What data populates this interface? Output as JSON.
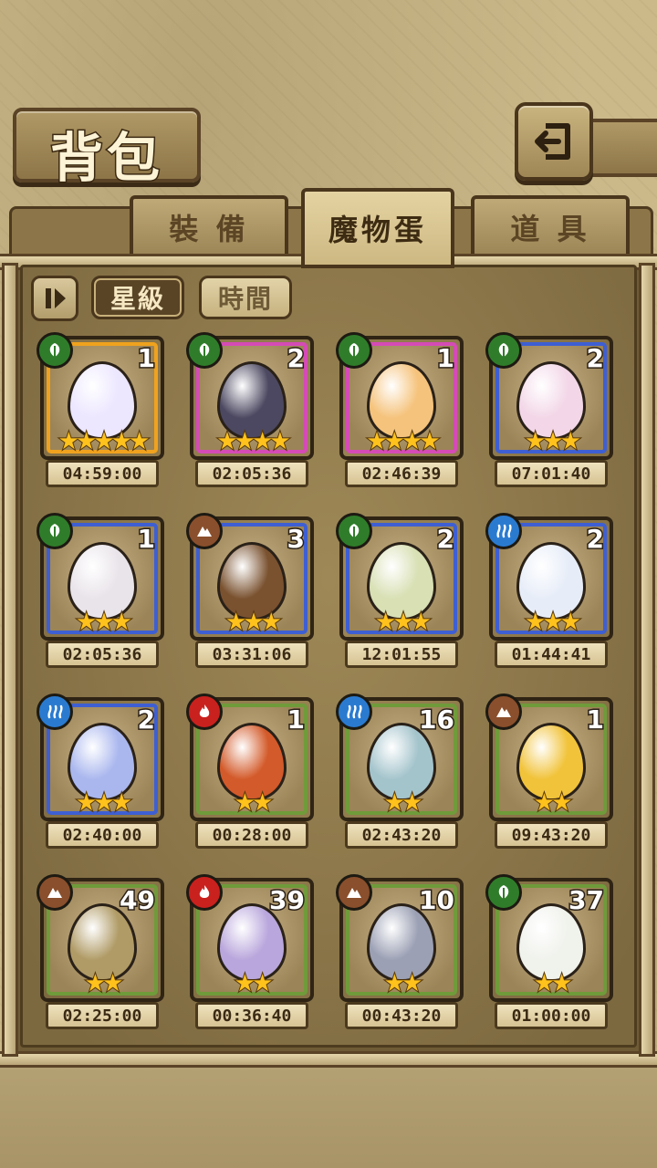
{
  "title": "背包",
  "tabs": [
    {
      "label": "裝 備",
      "active": false
    },
    {
      "label": "魔物蛋",
      "active": true
    },
    {
      "label": "道 具",
      "active": false
    }
  ],
  "filters": [
    {
      "label": "星級",
      "active": true
    },
    {
      "label": "時間",
      "active": false
    }
  ],
  "colors": {
    "rim_gold": "#f0a21e",
    "rim_pink": "#d54bb6",
    "rim_blue": "#3e5fd3",
    "rim_green": "#6f9b3a",
    "elem_leaf": "#2f7d2a",
    "elem_earth": "#8a4f2c",
    "elem_water": "#2a7bd0",
    "elem_fire": "#c9211e"
  },
  "eggs": [
    {
      "count": "1",
      "stars": "★★★★★",
      "timer": "04:59:00",
      "element": "leaf-icon",
      "rim": "gold",
      "egg_color": "#ece6ff"
    },
    {
      "count": "2",
      "stars": "★★★★",
      "timer": "02:05:36",
      "element": "leaf-icon",
      "rim": "pink",
      "egg_color": "#4c4861"
    },
    {
      "count": "1",
      "stars": "★★★★",
      "timer": "02:46:39",
      "element": "leaf-icon",
      "rim": "pink",
      "egg_color": "#f5c37c"
    },
    {
      "count": "2",
      "stars": "★★★",
      "timer": "07:01:40",
      "element": "leaf-icon",
      "rim": "blue",
      "egg_color": "#f3d7e8"
    },
    {
      "count": "1",
      "stars": "★★★",
      "timer": "02:05:36",
      "element": "leaf-icon",
      "rim": "blue",
      "egg_color": "#e9e4ea"
    },
    {
      "count": "3",
      "stars": "★★★",
      "timer": "03:31:06",
      "element": "earth-icon",
      "rim": "blue",
      "egg_color": "#7a5230"
    },
    {
      "count": "2",
      "stars": "★★★",
      "timer": "12:01:55",
      "element": "leaf-icon",
      "rim": "blue",
      "egg_color": "#d8e0b4"
    },
    {
      "count": "2",
      "stars": "★★★",
      "timer": "01:44:41",
      "element": "water-icon",
      "rim": "blue",
      "egg_color": "#e7edf8"
    },
    {
      "count": "2",
      "stars": "★★★",
      "timer": "02:40:00",
      "element": "water-icon",
      "rim": "blue",
      "egg_color": "#aab7ee"
    },
    {
      "count": "1",
      "stars": "★★",
      "timer": "00:28:00",
      "element": "fire-icon",
      "rim": "green",
      "egg_color": "#d35a2a"
    },
    {
      "count": "16",
      "stars": "★★",
      "timer": "02:43:20",
      "element": "water-icon",
      "rim": "green",
      "egg_color": "#a4c4cc"
    },
    {
      "count": "1",
      "stars": "★★",
      "timer": "09:43:20",
      "element": "earth-icon",
      "rim": "green",
      "egg_color": "#f1c33a"
    },
    {
      "count": "49",
      "stars": "★★",
      "timer": "02:25:00",
      "element": "earth-icon",
      "rim": "green",
      "egg_color": "#b09b66"
    },
    {
      "count": "39",
      "stars": "★★",
      "timer": "00:36:40",
      "element": "fire-icon",
      "rim": "green",
      "egg_color": "#b9a6dc"
    },
    {
      "count": "10",
      "stars": "★★",
      "timer": "00:43:20",
      "element": "earth-icon",
      "rim": "green",
      "egg_color": "#9ba0b4"
    },
    {
      "count": "37",
      "stars": "★★",
      "timer": "01:00:00",
      "element": "leaf-icon",
      "rim": "green",
      "egg_color": "#f0f2ec"
    }
  ]
}
